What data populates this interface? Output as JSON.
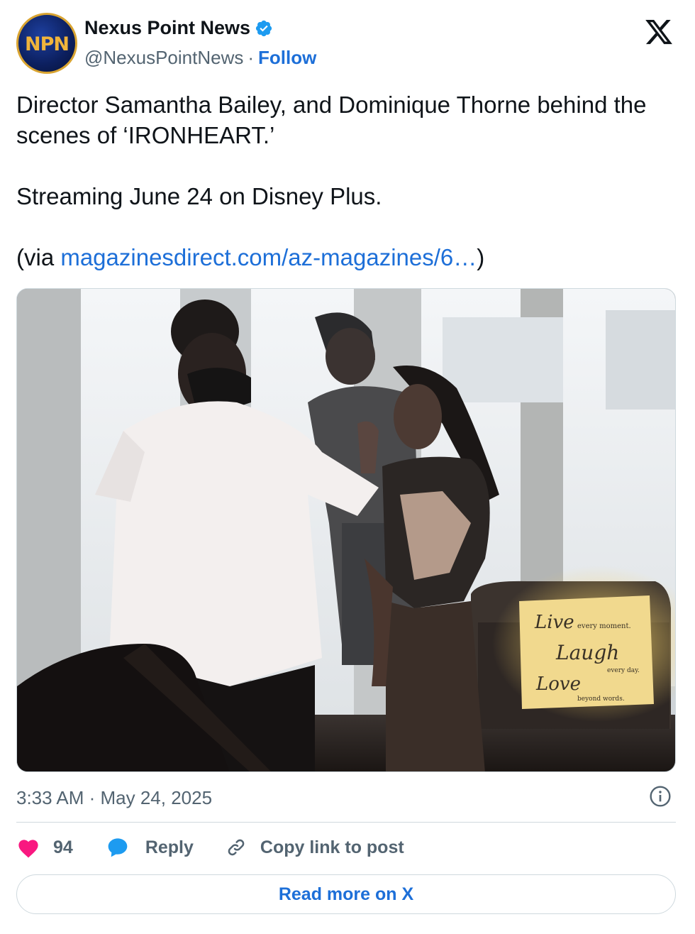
{
  "author": {
    "display_name": "Nexus Point News",
    "handle": "@NexusPointNews",
    "separator": "·",
    "follow_label": "Follow",
    "avatar_text": "NPN",
    "verified": true
  },
  "tweet": {
    "line1": "Director Samantha Bailey, and Dominique Thorne behind the scenes of ‘IRONHEART.’",
    "line2": "Streaming June 24 on Disney Plus.",
    "via_prefix": "(via ",
    "via_link": "magazinesdirect.com/az-magazines/6…",
    "via_suffix": ")"
  },
  "media": {
    "pillow_line1": "Live",
    "pillow_line1_small": "every moment.",
    "pillow_line2": "Laugh",
    "pillow_line2_small": "every day.",
    "pillow_line3": "Love",
    "pillow_line3_small": "beyond words."
  },
  "meta": {
    "timestamp": "3:33 AM · May 24, 2025"
  },
  "actions": {
    "like_count": "94",
    "reply_label": "Reply",
    "copy_label": "Copy link to post",
    "read_more_label": "Read more on X"
  },
  "colors": {
    "link": "#1d6fd8",
    "like": "#f91880",
    "reply_icon": "#1d9bf0",
    "verified": "#1d9bf0",
    "muted": "#536471"
  },
  "icons": [
    "verified-badge-icon",
    "x-logo-icon",
    "info-icon",
    "heart-icon",
    "reply-bubble-icon",
    "link-icon"
  ]
}
